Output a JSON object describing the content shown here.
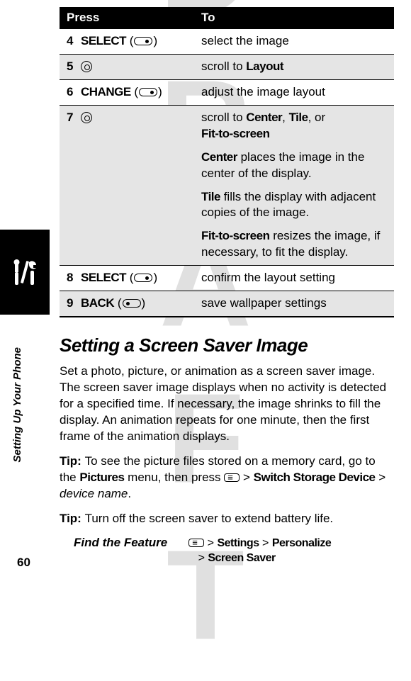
{
  "watermark": "DRAFT",
  "table": {
    "head_press": "Press",
    "head_to": "To",
    "rows": {
      "r4": {
        "num": "4",
        "key": "SELECT",
        "to": "select the image"
      },
      "r5": {
        "num": "5",
        "to": "scroll to ",
        "to_bold": "Layout"
      },
      "r6": {
        "num": "6",
        "key": "CHANGE",
        "to": "adjust the image layout"
      },
      "r7": {
        "num": "7",
        "to_a": "scroll to ",
        "to_b": "Center",
        "to_c": ", ",
        "to_d": "Tile",
        "to_e": ", or ",
        "to_f": "Fit-to-screen",
        "p_center_b": "Center",
        "p_center_t": " places the image in the center of the display.",
        "p_tile_b": "Tile",
        "p_tile_t": " fills the display with adjacent copies of the image.",
        "p_fit_b": "Fit-to-screen",
        "p_fit_t": " resizes the image, if necessary, to fit the display."
      },
      "r8": {
        "num": "8",
        "key": "SELECT",
        "to": "confirm the layout setting"
      },
      "r9": {
        "num": "9",
        "key": "BACK",
        "to": "save wallpaper settings"
      }
    }
  },
  "heading": "Setting a Screen Saver Image",
  "para1": "Set a photo, picture, or animation as a screen saver image. The screen saver image displays when no activity is detected for a specified time. If necessary, the image shrinks to fill the display. An animation repeats for one minute, then the first frame of the animation displays.",
  "tip1": {
    "label": "Tip: ",
    "a": "To see the picture files stored on a memory card, go to the ",
    "b": "Pictures",
    "c": " menu, then press ",
    "d": " > ",
    "e": "Switch Storage Device",
    "f": " > ",
    "g": "device name",
    "h": "."
  },
  "tip2": {
    "label": "Tip: ",
    "text": "Turn off the screen saver to extend battery life."
  },
  "find": {
    "label": "Find the Feature",
    "a": " > ",
    "b": "Settings",
    "c": " > ",
    "d": "Personalize",
    "e": " > ",
    "f": "Screen Saver"
  },
  "sidebar": "Setting Up Your Phone",
  "pagenum": "60"
}
